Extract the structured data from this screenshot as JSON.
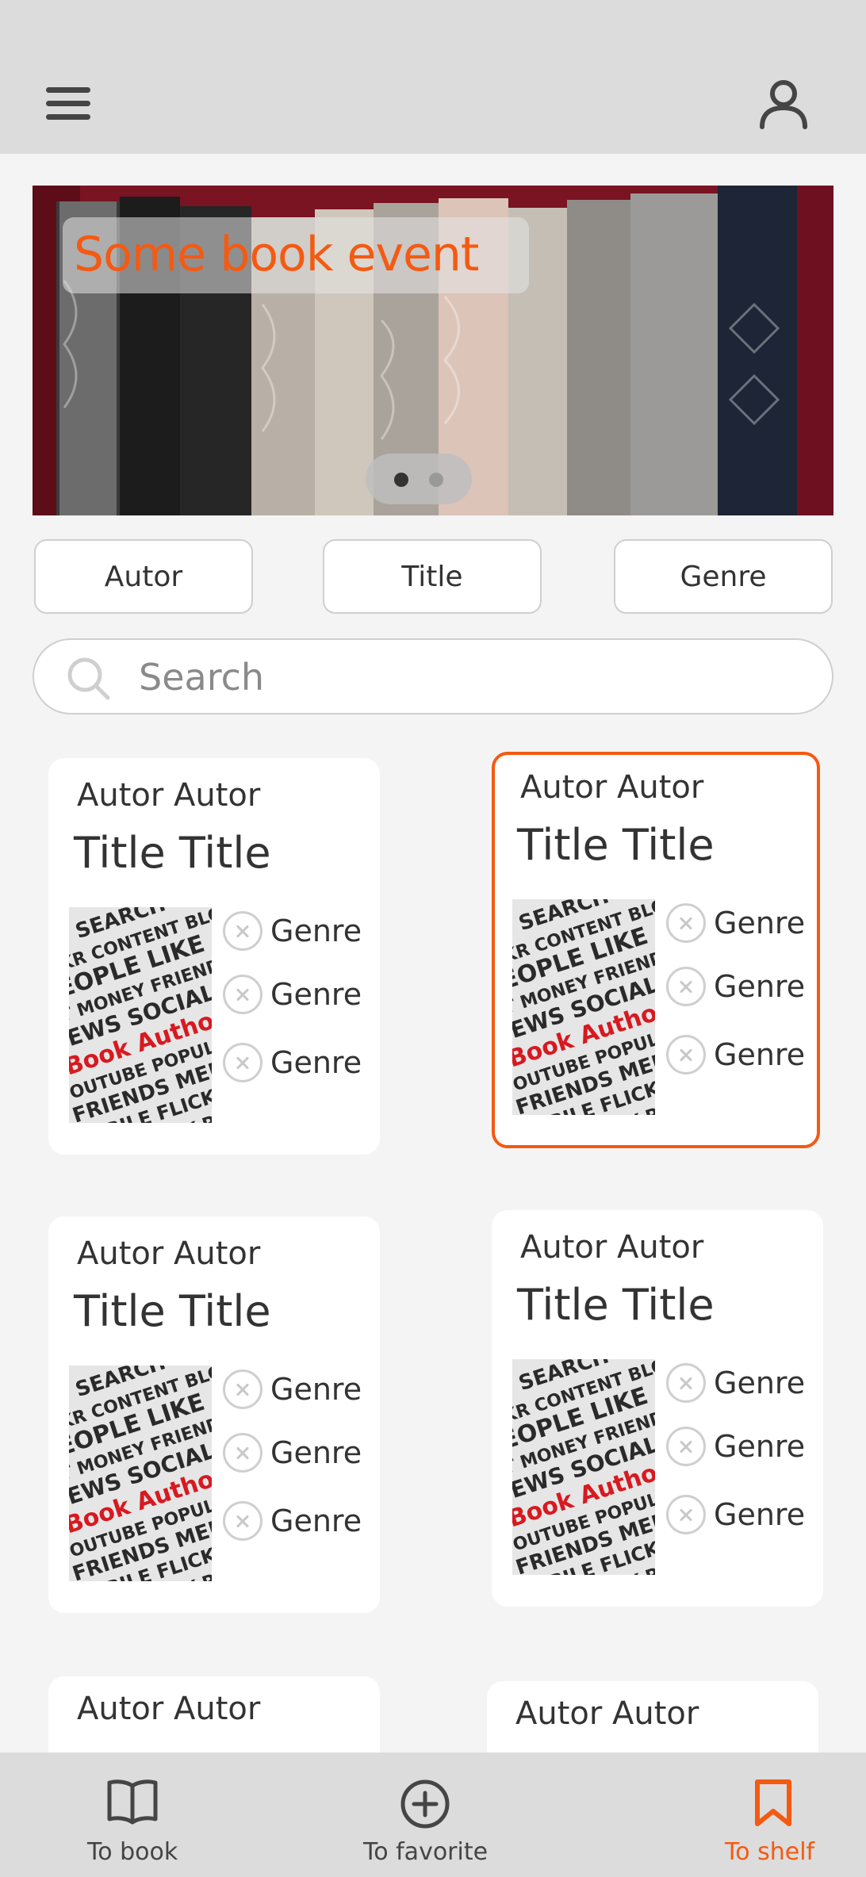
{
  "banner": {
    "title": "Some book event",
    "page_indicator": {
      "current": 1,
      "total": 2
    }
  },
  "filters": [
    "Autor",
    "Title",
    "Genre"
  ],
  "search": {
    "placeholder": "Search",
    "value": ""
  },
  "cards": [
    {
      "autor": "Autor Autor",
      "title": "Title Title",
      "genres": [
        "Genre",
        "Genre",
        "Genre"
      ],
      "selected": false
    },
    {
      "autor": "Autor Autor",
      "title": "Title Title",
      "genres": [
        "Genre",
        "Genre",
        "Genre"
      ],
      "selected": true
    },
    {
      "autor": "Autor Autor",
      "title": "Title Title",
      "genres": [
        "Genre",
        "Genre",
        "Genre"
      ],
      "selected": false
    },
    {
      "autor": "Autor Autor",
      "title": "Title Title",
      "genres": [
        "Genre",
        "Genre",
        "Genre"
      ],
      "selected": false
    },
    {
      "autor": "Autor Autor"
    },
    {
      "autor": "Autor Autor"
    }
  ],
  "nav": {
    "items": [
      {
        "label": "To book",
        "icon": "book-open-icon",
        "active": false
      },
      {
        "label": "To favorite",
        "icon": "plus-circle-icon",
        "active": false
      },
      {
        "label": "To shelf",
        "icon": "bookmark-icon",
        "active": true
      }
    ]
  },
  "colors": {
    "accent": "#f45a12",
    "bar": "#dcdcdc",
    "background": "#f4f4f4"
  }
}
